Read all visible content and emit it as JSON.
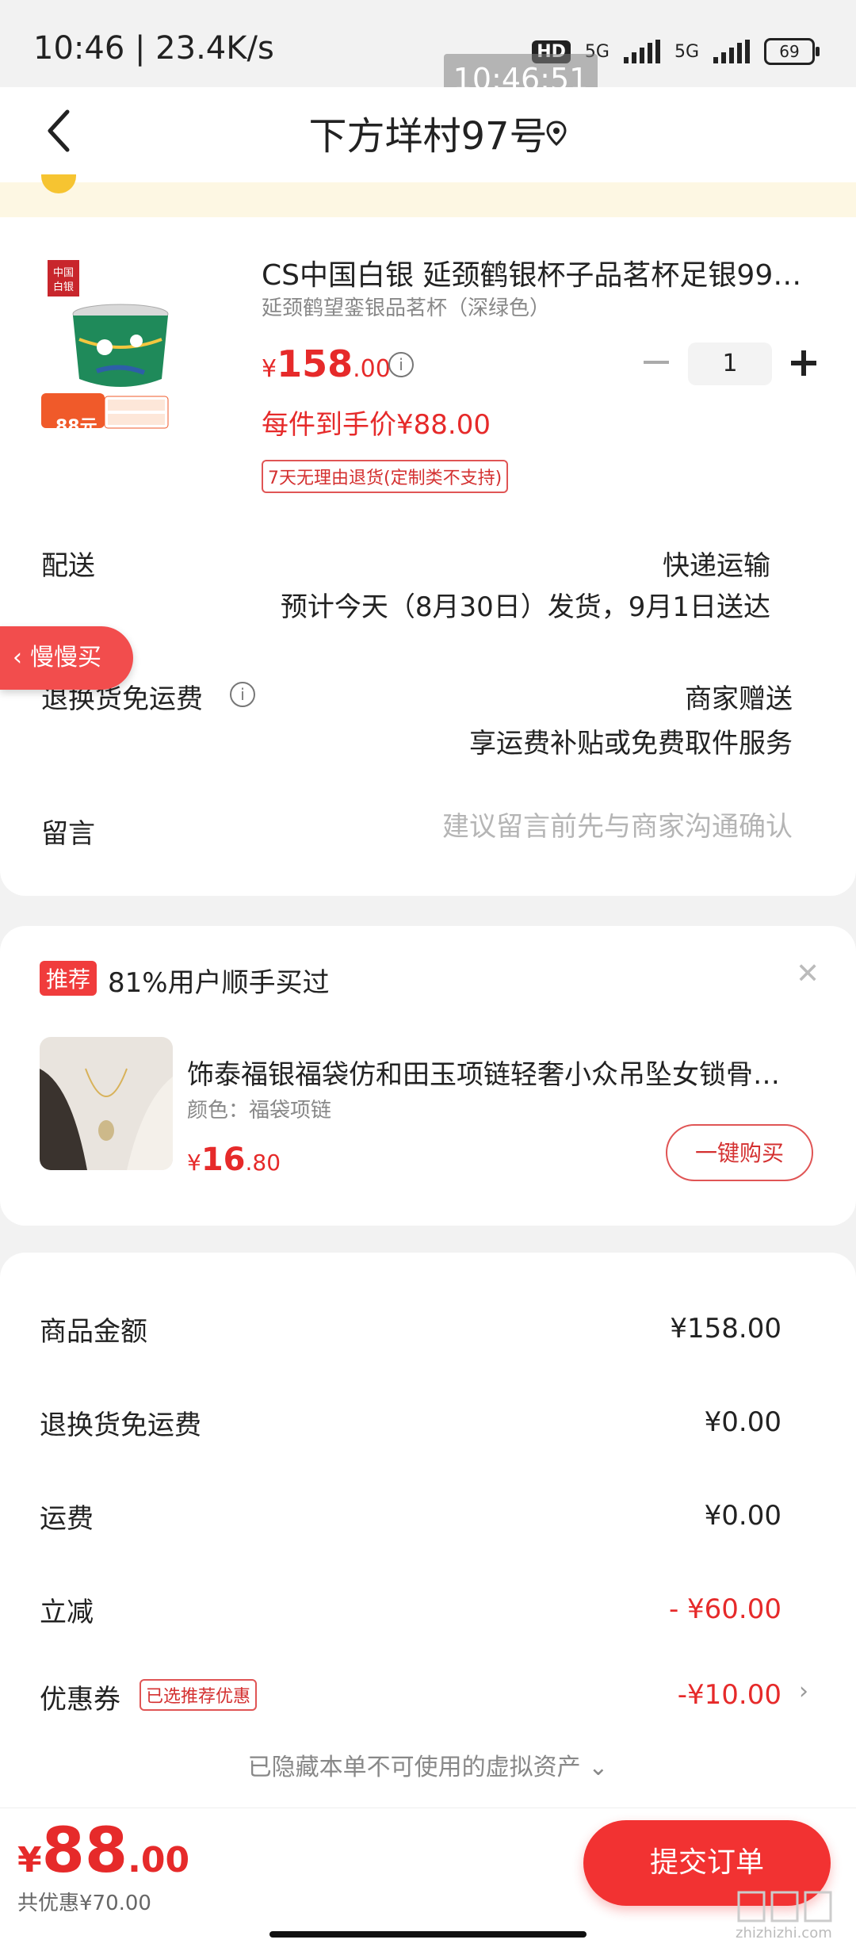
{
  "status_bar": {
    "time_speed": "10:46 | 23.4K/s",
    "hd_label": "HD",
    "net1": "5G",
    "net2": "5G",
    "battery": "69"
  },
  "clock_overlay": "10:46:51",
  "header": {
    "title": "下方垟村97号"
  },
  "product": {
    "title": "CS中国白银 延颈鹤银杯子品茗杯足银99…",
    "variant": "延颈鹤望銮银品茗杯（深绿色）",
    "price_yen": "¥",
    "price_int": "158",
    "price_dec": ".00",
    "quantity": "1",
    "unit_price": "每件到手价¥88.00",
    "return_policy": "7天无理由退货(定制类不支持)",
    "image_brand": "中国白银",
    "image_badge": "88元"
  },
  "delivery": {
    "label": "配送",
    "method": "快递运输",
    "estimate": "预计今天（8月30日）发货，9月1日送达"
  },
  "exchange": {
    "label": "退换货免运费",
    "value": "商家赠送",
    "detail": "享运费补贴或免费取件服务"
  },
  "message": {
    "label": "留言",
    "placeholder": "建议留言前先与商家沟通确认"
  },
  "slow_buy_tab": "慢慢买",
  "recommend": {
    "tag": "推荐",
    "text": "81%用户顺手买过",
    "item_title": "饰泰福银福袋仿和田玉项链轻奢小众吊坠女锁骨…",
    "item_variant": "颜色：福袋项链",
    "price_yen": "¥",
    "price_int": "16",
    "price_dec": ".80",
    "buy_label": "一键购买"
  },
  "summary": {
    "rows": [
      {
        "label": "商品金额",
        "value": "¥158.00"
      },
      {
        "label": "退换货免运费",
        "value": "¥0.00"
      },
      {
        "label": "运费",
        "value": "¥0.00"
      },
      {
        "label": "立减",
        "value": "- ¥60.00"
      },
      {
        "label": "优惠券",
        "value": "-¥10.00"
      }
    ],
    "coupon_badge": "已选推荐优惠",
    "hidden_assets": "已隐藏本单不可使用的虚拟资产"
  },
  "bottom": {
    "total_yen": "¥",
    "total_int": "88",
    "total_dec": ".00",
    "saved": "共优惠¥70.00",
    "submit_label": "提交订单"
  },
  "watermark": "zhizhizhi.com",
  "colors": {
    "accent": "#e62a2a",
    "button": "#f23232"
  }
}
